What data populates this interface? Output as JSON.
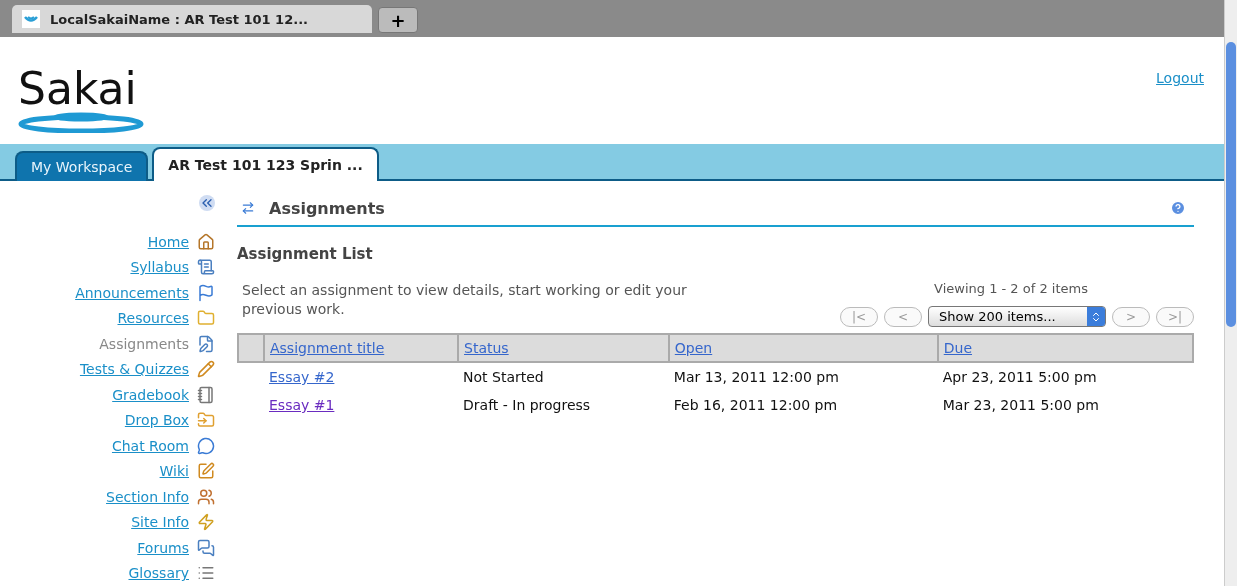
{
  "browser_tabs": [
    {
      "label": "LocalSakaiName : AR Test 101 12...",
      "selected": true
    }
  ],
  "new_tab_button": "+",
  "logo": "Sakai",
  "logout": "Logout",
  "site_tabs": [
    {
      "label": "My Workspace",
      "selected": false
    },
    {
      "label": "AR Test 101 123 Sprin ...",
      "selected": true
    }
  ],
  "sidebar": {
    "items": [
      {
        "label": "Home",
        "selected": false
      },
      {
        "label": "Syllabus",
        "selected": false
      },
      {
        "label": "Announcements",
        "selected": false
      },
      {
        "label": "Resources",
        "selected": false
      },
      {
        "label": "Assignments",
        "selected": true
      },
      {
        "label": "Tests & Quizzes",
        "selected": false
      },
      {
        "label": "Gradebook",
        "selected": false
      },
      {
        "label": "Drop Box",
        "selected": false
      },
      {
        "label": "Chat Room",
        "selected": false
      },
      {
        "label": "Wiki",
        "selected": false
      },
      {
        "label": "Section Info",
        "selected": false
      },
      {
        "label": "Site Info",
        "selected": false
      },
      {
        "label": "Forums",
        "selected": false
      },
      {
        "label": "Glossary",
        "selected": false
      }
    ]
  },
  "tool_title": "Assignments",
  "list_title": "Assignment List",
  "instructions": "Select an assignment to view details, start working or edit your previous work.",
  "pager": {
    "viewing": "Viewing 1 - 2 of 2 items",
    "first": "|<",
    "prev": "<",
    "page_size": "Show 200 items...",
    "next": ">",
    "last": ">|"
  },
  "table": {
    "columns": [
      "Assignment title",
      "Status",
      "Open",
      "Due"
    ],
    "rows": [
      {
        "title": "Essay #2",
        "visited": false,
        "status": "Not Started",
        "open": "Mar 13, 2011 12:00 pm",
        "due": "Apr 23, 2011 5:00 pm"
      },
      {
        "title": "Essay #1",
        "visited": true,
        "status": "Draft - In progress",
        "open": "Feb 16, 2011 12:00 pm",
        "due": "Mar 23, 2011 5:00 pm"
      }
    ]
  }
}
